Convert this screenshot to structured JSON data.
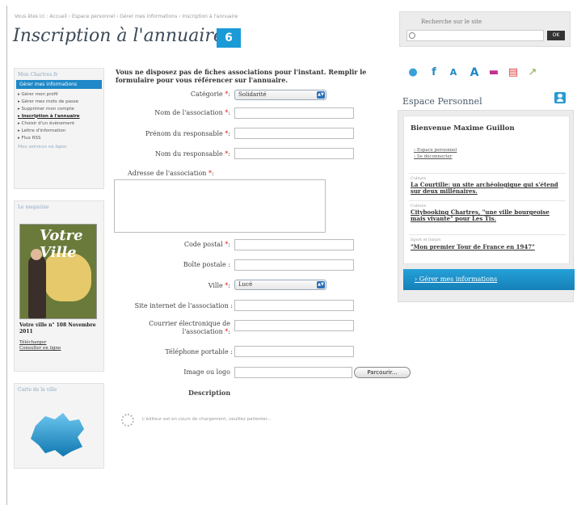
{
  "breadcrumb": "Vous êtes ici : Accueil › Espace personnel › Gérer mes informations › Inscription à l'annuaire",
  "page_title": "Inscription à l'annuaire",
  "badge_number": "6",
  "search": {
    "label": "Recherche sur le site",
    "button": "OK"
  },
  "sidebar": {
    "title": "Mon Chartres.fr",
    "active_item": "Gérer mes informations",
    "items": [
      "Gérer mon profil",
      "Gérer mes mots de passe",
      "Supprimer mon compte",
      "Inscription à l'annuaire",
      "Choisir d'un évènement",
      "Lettre d'information",
      "Flux RSS"
    ],
    "current_index": 3,
    "footer": "Mes services en ligne"
  },
  "magazine": {
    "box_title": "Le magazine",
    "cover_title": "Votre Ville",
    "caption": "Votre ville n° 108 Novembre 2011",
    "links": [
      "Télécharger",
      "Consulter en ligne"
    ]
  },
  "region_box": {
    "title": "Carte de la ville"
  },
  "form": {
    "intro": "Vous ne disposez pas de fiches associations pour l'instant. Remplir le formulaire pour vous référencer sur l'annuaire.",
    "category_label": "Catégorie",
    "category_value": "Solidarité",
    "name_label": "Nom de l'association",
    "first_name_label": "Prénom du responsable",
    "last_name_label": "Nom du responsable",
    "address_label": "Adresse de l'association",
    "postal_code_label": "Code postal",
    "po_box_label": "Boîte postale :",
    "city_label": "Ville",
    "city_value": "Lucé",
    "website_label": "Site internet de l'association :",
    "email_label_1": "Courrier électronique de",
    "email_label_2": "l'association",
    "phone_label": "Téléphone portable :",
    "image_label": "Image ou logo",
    "browse_button": "Parcourir...",
    "description_label": "Description",
    "loading_text": "L'éditeur est en cours de chargement, veuillez patienter..."
  },
  "right": {
    "espace_title": "Espace Personnel",
    "welcome": "Bienvenue Maxime Guillon",
    "links": [
      "Espace personnel",
      "Se déconnecter"
    ],
    "articles": [
      {
        "category": "Culture",
        "title": "La Courtille: un site archéologique qui s'étend sur deux millénaires."
      },
      {
        "category": "Culture",
        "title": "Citybooking Chartres, \"une ville bourgeoise mais vivante\" pour Les Tis."
      },
      {
        "category": "Sport et loisirs",
        "title": "\"Mon premier Tour de France en 1947\""
      }
    ],
    "manage_button": "Gérer mes informations"
  },
  "colors": {
    "accent": "#1e88c8",
    "title": "#3c4a58",
    "required": "#d11111"
  }
}
